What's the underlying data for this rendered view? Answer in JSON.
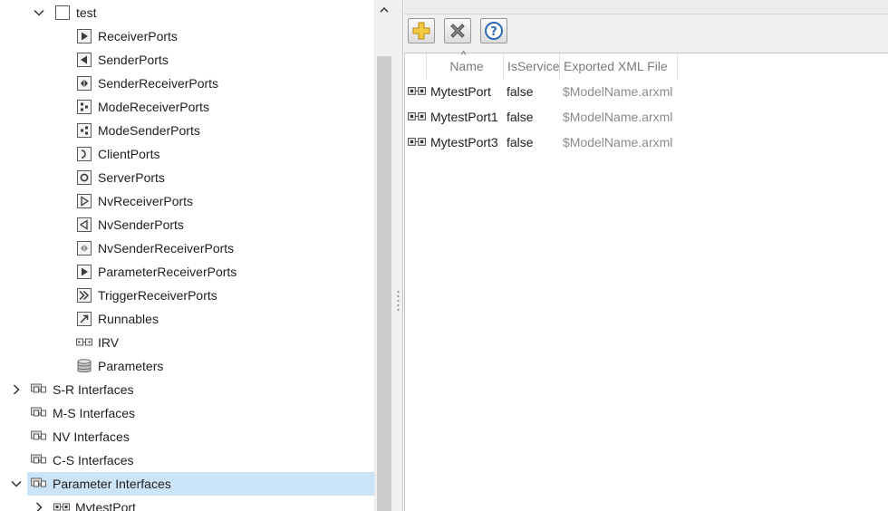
{
  "tree": {
    "rows": [
      {
        "label": "test",
        "icon": "checkbox-icon",
        "expander": "expanded",
        "selected": false
      },
      {
        "label": "ReceiverPorts",
        "icon": "receiver-port-icon",
        "expander": "none",
        "selected": false
      },
      {
        "label": "SenderPorts",
        "icon": "sender-port-icon",
        "expander": "none",
        "selected": false
      },
      {
        "label": "SenderReceiverPorts",
        "icon": "sender-receiver-port-icon",
        "expander": "none",
        "selected": false
      },
      {
        "label": "ModeReceiverPorts",
        "icon": "mode-receiver-port-icon",
        "expander": "none",
        "selected": false
      },
      {
        "label": "ModeSenderPorts",
        "icon": "mode-sender-port-icon",
        "expander": "none",
        "selected": false
      },
      {
        "label": "ClientPorts",
        "icon": "client-port-icon",
        "expander": "none",
        "selected": false
      },
      {
        "label": "ServerPorts",
        "icon": "server-port-icon",
        "expander": "none",
        "selected": false
      },
      {
        "label": "NvReceiverPorts",
        "icon": "nv-receiver-port-icon",
        "expander": "none",
        "selected": false
      },
      {
        "label": "NvSenderPorts",
        "icon": "nv-sender-port-icon",
        "expander": "none",
        "selected": false
      },
      {
        "label": "NvSenderReceiverPorts",
        "icon": "nv-sender-receiver-port-icon",
        "expander": "none",
        "selected": false
      },
      {
        "label": "ParameterReceiverPorts",
        "icon": "parameter-receiver-port-icon",
        "expander": "none",
        "selected": false
      },
      {
        "label": "TriggerReceiverPorts",
        "icon": "trigger-receiver-port-icon",
        "expander": "none",
        "selected": false
      },
      {
        "label": "Runnables",
        "icon": "runnable-icon",
        "expander": "none",
        "selected": false
      },
      {
        "label": "IRV",
        "icon": "irv-icon",
        "expander": "none",
        "selected": false
      },
      {
        "label": "Parameters",
        "icon": "database-icon",
        "expander": "none",
        "selected": false
      },
      {
        "label": "S-R Interfaces",
        "icon": "interface-icon",
        "expander": "collapsed",
        "selected": false
      },
      {
        "label": "M-S Interfaces",
        "icon": "interface-icon",
        "expander": "none",
        "selected": false
      },
      {
        "label": "NV Interfaces",
        "icon": "interface-icon",
        "expander": "none",
        "selected": false
      },
      {
        "label": "C-S Interfaces",
        "icon": "interface-icon",
        "expander": "none",
        "selected": false
      },
      {
        "label": "Parameter Interfaces",
        "icon": "interface-icon",
        "expander": "expanded",
        "selected": true
      },
      {
        "label": "MytestPort",
        "icon": "port-interface-icon",
        "expander": "collapsed",
        "selected": false
      }
    ]
  },
  "toolbar": {
    "add_icon": "add-icon",
    "delete_icon": "delete-icon",
    "help_icon": "help-icon"
  },
  "table": {
    "columns": [
      "Name",
      "IsService",
      "Exported XML File"
    ],
    "sort_indicator": "^",
    "rows": [
      {
        "name": "MytestPort",
        "isservice": "false",
        "file": "$ModelName.arxml"
      },
      {
        "name": "MytestPort1",
        "isservice": "false",
        "file": "$ModelName.arxml"
      },
      {
        "name": "MytestPort3",
        "isservice": "false",
        "file": "$ModelName.arxml"
      }
    ]
  },
  "colors": {
    "selection": "#cce4f7",
    "add": "#f2c230",
    "delete": "#7a7a7a",
    "help": "#2e6bb8"
  }
}
